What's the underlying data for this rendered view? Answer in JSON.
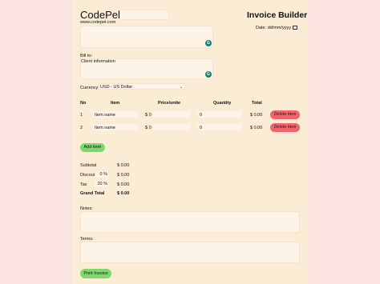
{
  "colors": {
    "background": "#fbe3e0",
    "page": "#fbecd5",
    "field": "#fdf3e7",
    "add_button": "#7fd86c",
    "delete_button": "#f0646b",
    "grammarly_badge": "#16856e"
  },
  "header": {
    "company": "CodePel",
    "website": "www.codepel.com",
    "title": "Invoice Builder",
    "date_label": "Date:",
    "date_placeholder": "dd/mm/yyyy",
    "date_icon": "calendar-icon",
    "grammarly_icon": "G"
  },
  "bill": {
    "label": "Bill to:",
    "client": "Client information"
  },
  "currency": {
    "label": "Currency:",
    "selected": "USD - US Dollar"
  },
  "table": {
    "headers": [
      "No",
      "Item",
      "Price/unite",
      "Quantity",
      "Total"
    ],
    "rows": [
      {
        "no": "1",
        "item": "Item name",
        "price": "$ 0",
        "qty": "0",
        "total": "$ 0.00",
        "action": "Delete item"
      },
      {
        "no": "2",
        "item": "Item name",
        "price": "$ 0",
        "qty": "0",
        "total": "$ 0.00",
        "action": "Delete item"
      }
    ]
  },
  "add_item_label": "Add item",
  "totals": {
    "subtotal_label": "Subtotal",
    "subtotal": "$ 0.00",
    "discount_label": "Discount",
    "discount_pct": "0 %",
    "discount": "$ 0.00",
    "tax_label": "Tax",
    "tax_pct": "20 %",
    "tax": "$ 0.00",
    "grand_label": "Grand Total",
    "grand": "$ 0.00"
  },
  "notes_label": "Notes:",
  "terms_label": "Terms:",
  "print_label": "Print Invoice"
}
